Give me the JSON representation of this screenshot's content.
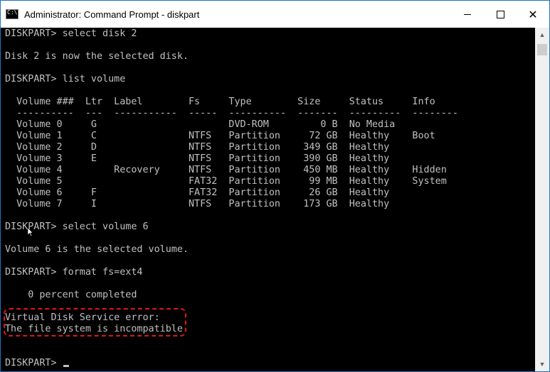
{
  "window": {
    "title": "Administrator: Command Prompt - diskpart",
    "icon": "cmd-icon",
    "controls": {
      "minimize": "minimize-icon",
      "maximize": "maximize-icon",
      "close": "✕"
    }
  },
  "console": {
    "lines": [
      "DISKPART> select disk 2",
      "",
      "Disk 2 is now the selected disk.",
      "",
      "DISKPART> list volume",
      "",
      "  Volume ###  Ltr  Label        Fs     Type        Size     Status     Info",
      "  ----------  ---  -----------  -----  ----------  -------  ---------  --------",
      "  Volume 0     G                       DVD-ROM         0 B  No Media",
      "  Volume 1     C                NTFS   Partition     72 GB  Healthy    Boot",
      "  Volume 2     D                NTFS   Partition    349 GB  Healthy",
      "  Volume 3     E                NTFS   Partition    390 GB  Healthy",
      "  Volume 4         Recovery     NTFS   Partition    450 MB  Healthy    Hidden",
      "  Volume 5                      FAT32  Partition     99 MB  Healthy    System",
      "  Volume 6     F                FAT32  Partition     26 GB  Healthy",
      "  Volume 7     I                NTFS   Partition    173 GB  Healthy",
      "",
      "DISKPART> select volume 6",
      "",
      "Volume 6 is the selected volume.",
      "",
      "DISKPART> format fs=ext4",
      "",
      "    0 percent completed",
      "",
      "Virtual Disk Service error:",
      "The file system is incompatible.",
      "",
      "",
      "DISKPART> "
    ]
  },
  "colors": {
    "console_bg": "#000000",
    "console_text": "#c0c0c0",
    "highlight": "#e0141b"
  }
}
